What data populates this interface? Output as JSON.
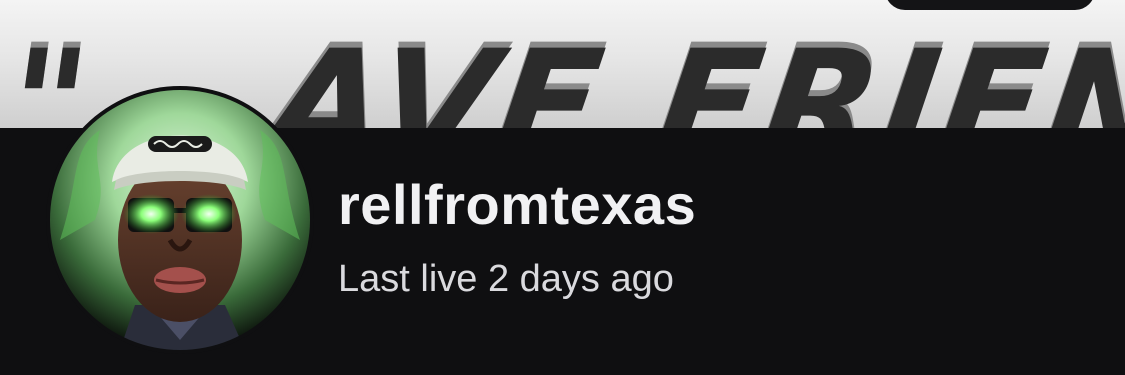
{
  "banner": {
    "image_text": "\"...AVE FRIENDS THO\""
  },
  "profile": {
    "username": "rellfromtexas",
    "last_live": "Last live 2 days ago",
    "avatar_icon": "avatar-illustration"
  },
  "colors": {
    "panel_bg": "#0f0f11",
    "username_color": "#f1f1f3",
    "status_color": "#dadade",
    "glow_green": "#57e84a"
  }
}
